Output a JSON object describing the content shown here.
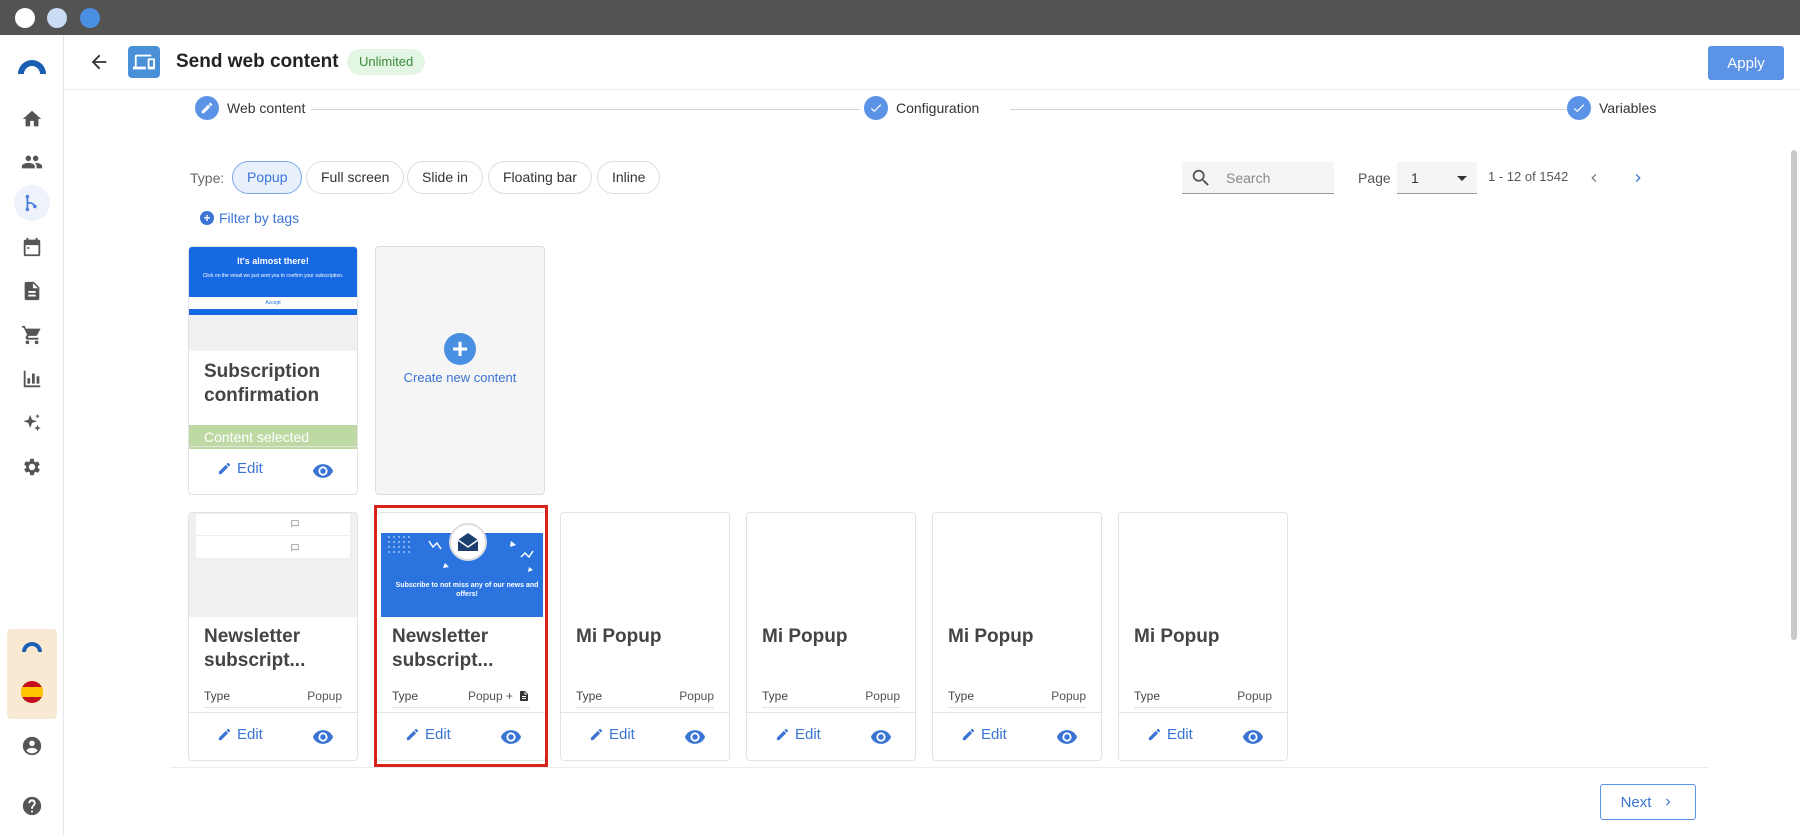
{
  "header": {
    "title": "Send web content",
    "badge": "Unlimited",
    "apply_label": "Apply"
  },
  "stepper": {
    "steps": [
      {
        "label": "Web content",
        "icon": "pencil-icon"
      },
      {
        "label": "Configuration",
        "icon": "check-icon"
      },
      {
        "label": "Variables",
        "icon": "check-icon"
      }
    ]
  },
  "filters": {
    "type_label": "Type:",
    "chips": [
      "Popup",
      "Full screen",
      "Slide in",
      "Floating bar",
      "Inline"
    ],
    "active_chip": "Popup",
    "filter_tags_label": "Filter by tags"
  },
  "search": {
    "placeholder": "Search"
  },
  "pagination": {
    "page_label": "Page",
    "page_value": "1",
    "range": "1 - 12 of 1542"
  },
  "create_card": {
    "label": "Create new content"
  },
  "cards": [
    {
      "title": "Subscription confirmation",
      "selected_label": "Content selected",
      "thumb_heading": "It's almost there!",
      "thumb_text": "Click on the email we just sent you to confirm your subscription.",
      "thumb_button": "Accept",
      "edit_label": "Edit"
    },
    {
      "title": "Newsletter subscript...",
      "meta_key": "Type",
      "meta_value": "Popup",
      "edit_label": "Edit"
    },
    {
      "title": "Newsletter subscript...",
      "meta_key": "Type",
      "meta_value": "Popup +",
      "thumb_text": "Subscribe to not miss any of our news and offers!",
      "edit_label": "Edit"
    },
    {
      "title": "Mi Popup",
      "meta_key": "Type",
      "meta_value": "Popup",
      "edit_label": "Edit"
    },
    {
      "title": "Mi Popup",
      "meta_key": "Type",
      "meta_value": "Popup",
      "edit_label": "Edit"
    },
    {
      "title": "Mi Popup",
      "meta_key": "Type",
      "meta_value": "Popup",
      "edit_label": "Edit"
    },
    {
      "title": "Mi Popup",
      "meta_key": "Type",
      "meta_value": "Popup",
      "edit_label": "Edit"
    }
  ],
  "footer": {
    "next_label": "Next"
  },
  "colors": {
    "accent": "#5b93e6",
    "link": "#3a74d4",
    "selected": "#bfd9a4",
    "highlight": "#d9221c",
    "badge_bg": "#e3f5e3"
  }
}
